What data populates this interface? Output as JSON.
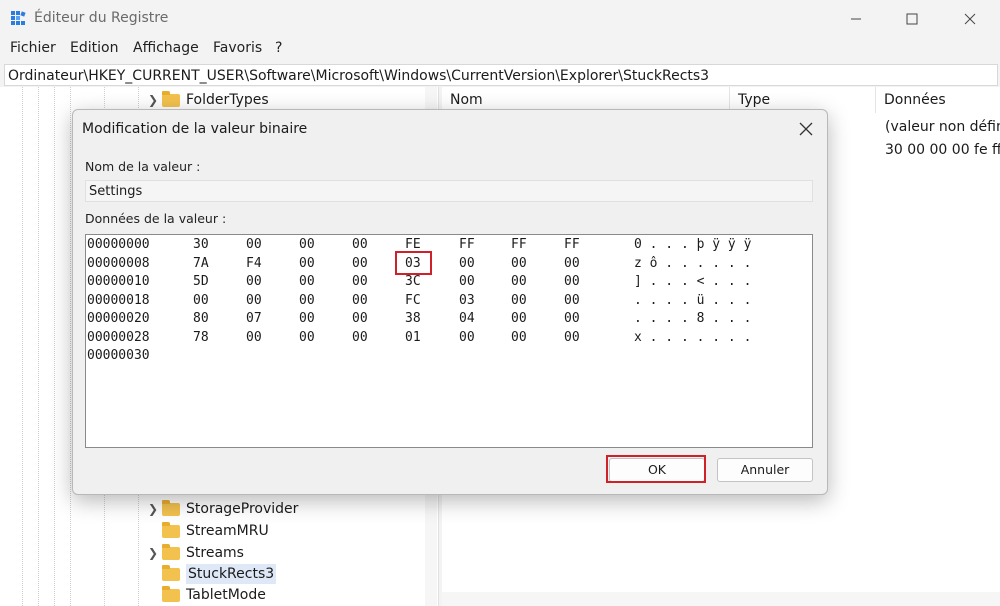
{
  "window": {
    "title": "Éditeur du Registre"
  },
  "menu": [
    "Fichier",
    "Edition",
    "Affichage",
    "Favoris",
    "?"
  ],
  "address": "Ordinateur\\HKEY_CURRENT_USER\\Software\\Microsoft\\Windows\\CurrentVersion\\Explorer\\StuckRects3",
  "tree": {
    "items": [
      {
        "label": "FolderTypes",
        "expandable": true,
        "selected": false
      },
      {
        "label": "StorageProvider",
        "expandable": true,
        "selected": false
      },
      {
        "label": "StreamMRU",
        "expandable": false,
        "selected": false
      },
      {
        "label": "Streams",
        "expandable": true,
        "selected": false
      },
      {
        "label": "StuckRects3",
        "expandable": false,
        "selected": true
      },
      {
        "label": "TabletMode",
        "expandable": false,
        "selected": false
      }
    ]
  },
  "list": {
    "columns": [
      "Nom",
      "Type",
      "Données"
    ],
    "rows": [
      {
        "data": "(valeur non défini"
      },
      {
        "data": "30 00 00 00 fe ff f"
      }
    ]
  },
  "dialog": {
    "title": "Modification de la valeur binaire",
    "name_label": "Nom de la valeur :",
    "name_value": "Settings",
    "data_label": "Données de la valeur :",
    "hex_rows": [
      {
        "offset": "00000000",
        "bytes": [
          "30",
          "00",
          "00",
          "00",
          "FE",
          "FF",
          "FF",
          "FF"
        ],
        "ascii": "0 . . . þ ÿ ÿ ÿ"
      },
      {
        "offset": "00000008",
        "bytes": [
          "7A",
          "F4",
          "00",
          "00",
          "03",
          "00",
          "00",
          "00"
        ],
        "ascii": "z ô . . . . . ."
      },
      {
        "offset": "00000010",
        "bytes": [
          "5D",
          "00",
          "00",
          "00",
          "3C",
          "00",
          "00",
          "00"
        ],
        "ascii": "] . . . < . . ."
      },
      {
        "offset": "00000018",
        "bytes": [
          "00",
          "00",
          "00",
          "00",
          "FC",
          "03",
          "00",
          "00"
        ],
        "ascii": ". . . . ü . . ."
      },
      {
        "offset": "00000020",
        "bytes": [
          "80",
          "07",
          "00",
          "00",
          "38",
          "04",
          "00",
          "00"
        ],
        "ascii": ". . . . 8 . . ."
      },
      {
        "offset": "00000028",
        "bytes": [
          "78",
          "00",
          "00",
          "00",
          "01",
          "00",
          "00",
          "00"
        ],
        "ascii": "x . . . . . . ."
      },
      {
        "offset": "00000030",
        "bytes": [],
        "ascii": ""
      }
    ],
    "ok_label": "OK",
    "cancel_label": "Annuler",
    "highlight_color": "#d0202a"
  }
}
